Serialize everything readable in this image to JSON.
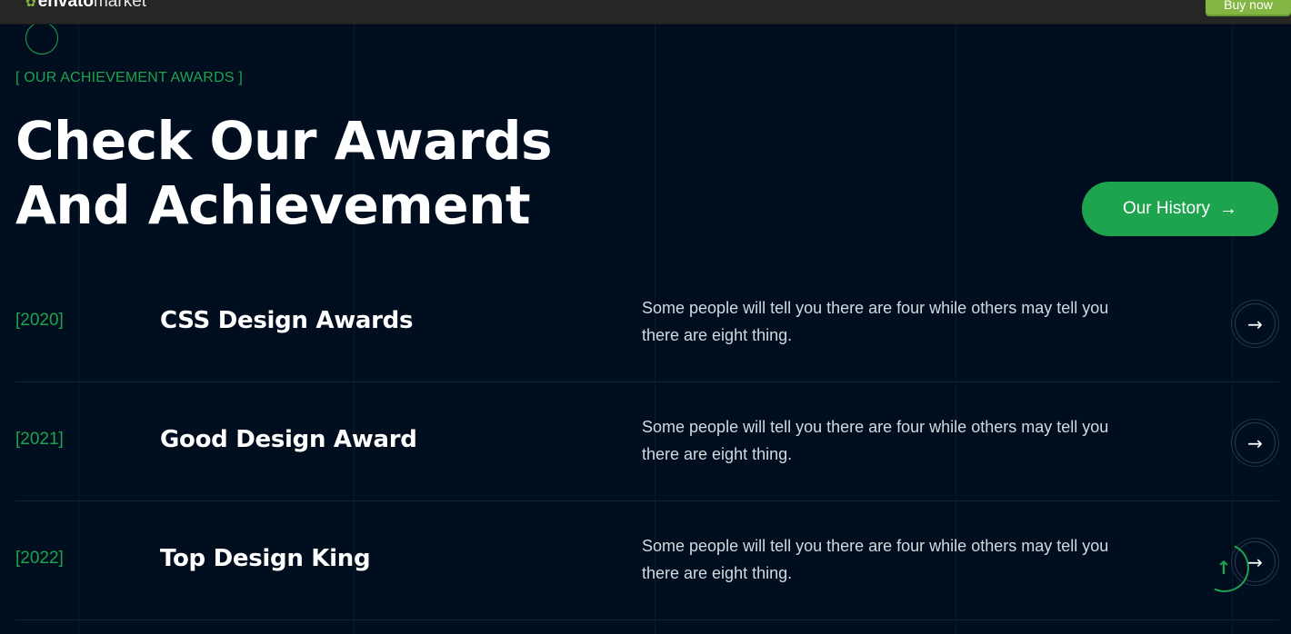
{
  "topbar": {
    "brand_part1": "envato",
    "brand_part2": "market",
    "buy_label": "Buy now"
  },
  "section": {
    "eyebrow": "[ OUR ACHIEVEMENT AWARDS ]",
    "title_line1": "Check Our Awards",
    "title_line2": "And Achievement",
    "history_button": "Our History"
  },
  "awards": [
    {
      "year": "[2020]",
      "name": "CSS Design Awards",
      "description": "Some people will tell you there are four while others may tell you there are eight thing."
    },
    {
      "year": "[2021]",
      "name": "Good Design Award",
      "description": "Some people will tell you there are four while others may tell you there are eight thing."
    },
    {
      "year": "[2022]",
      "name": "Top Design King",
      "description": "Some people will tell you there are four while others may tell you there are eight thing."
    }
  ],
  "icons": {
    "arrow_right": "arrow-right-icon",
    "arrow_up": "arrow-up-icon"
  },
  "colors": {
    "background": "#010e1f",
    "accent_green": "#1ea34f",
    "envato_green": "#82b541"
  }
}
